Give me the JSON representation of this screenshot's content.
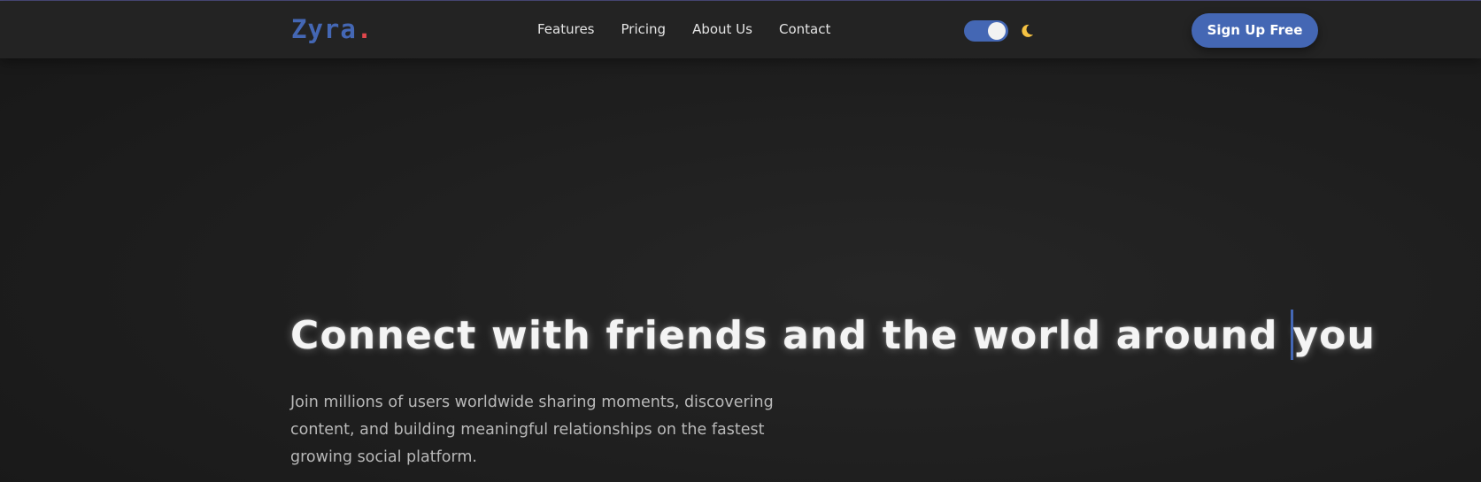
{
  "brand": {
    "name": "Zyra",
    "dot": ".",
    "color": "#4467b4",
    "dot_color": "#e0474c"
  },
  "nav": {
    "links": [
      {
        "label": "Features"
      },
      {
        "label": "Pricing"
      },
      {
        "label": "About Us"
      },
      {
        "label": "Contact"
      }
    ]
  },
  "theme_toggle": {
    "state": "on",
    "icon": "moon-icon",
    "color": "#4467b4"
  },
  "header": {
    "signup_label": "Sign Up Free"
  },
  "hero": {
    "title": "Connect with friends and the world around you",
    "subtitle": "Join millions of users worldwide sharing moments, discovering content, and building meaningful relationships on the fastest growing social platform."
  }
}
